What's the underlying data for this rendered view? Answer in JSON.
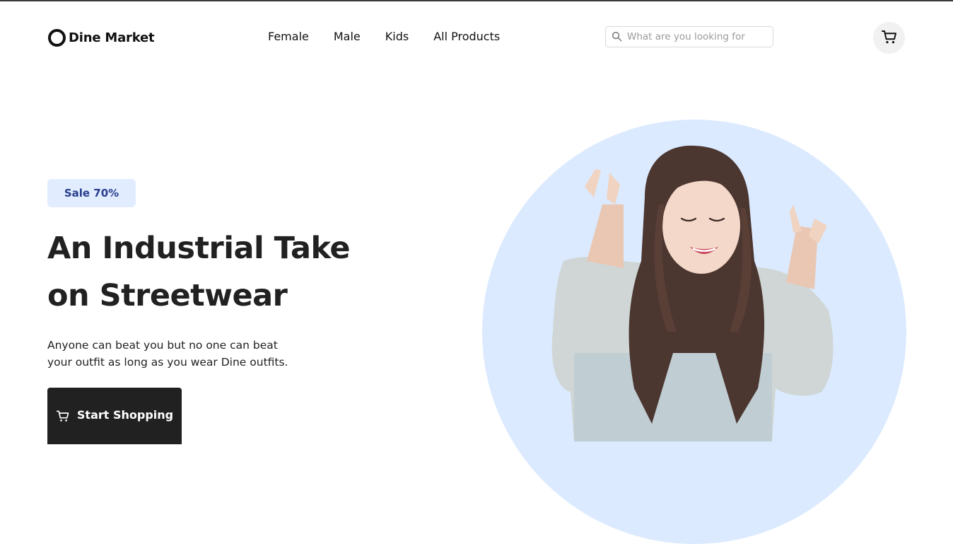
{
  "brand": {
    "name": "Dine Market",
    "icon": "ring-logo-icon"
  },
  "nav": {
    "items": [
      {
        "label": "Female"
      },
      {
        "label": "Male"
      },
      {
        "label": "Kids"
      },
      {
        "label": "All Products"
      }
    ]
  },
  "search": {
    "placeholder": "What are you looking for",
    "value": "",
    "icon": "search-icon"
  },
  "cart": {
    "icon": "cart-icon"
  },
  "hero": {
    "badge": "Sale 70%",
    "title_line1": "An Industrial Take",
    "title_line2": "on Streetwear",
    "desc_line1": "Anyone can beat you but no one can beat",
    "desc_line2": "your outfit as long as you wear Dine outfits.",
    "cta_label": "Start Shopping",
    "cta_icon": "cart-icon"
  },
  "colors": {
    "accent_dark": "#212121",
    "badge_bg": "#e1edff",
    "badge_text": "#2a3e8c",
    "hero_circle": "#dbeaff",
    "cart_bg": "#f1f1f1"
  }
}
